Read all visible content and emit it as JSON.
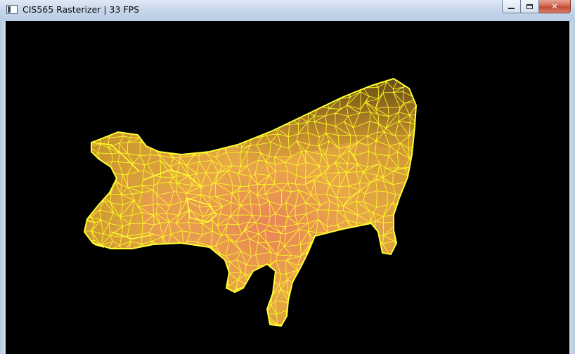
{
  "window": {
    "title": "CIS565 Rasterizer | 33 FPS",
    "controls": {
      "minimize": "minimize",
      "maximize": "maximize",
      "close": "✕"
    }
  },
  "scene": {
    "background": "#000000",
    "model": "cow",
    "render_mode": "wireframe",
    "wire_color": "#ffff22",
    "fill_colors": [
      "#d88a3a",
      "#f0b050",
      "#e08860",
      "#6b4b15"
    ]
  },
  "icons": {
    "app": "app-window-icon",
    "minimize": "minimize-icon",
    "maximize": "maximize-icon",
    "close": "close-icon"
  }
}
